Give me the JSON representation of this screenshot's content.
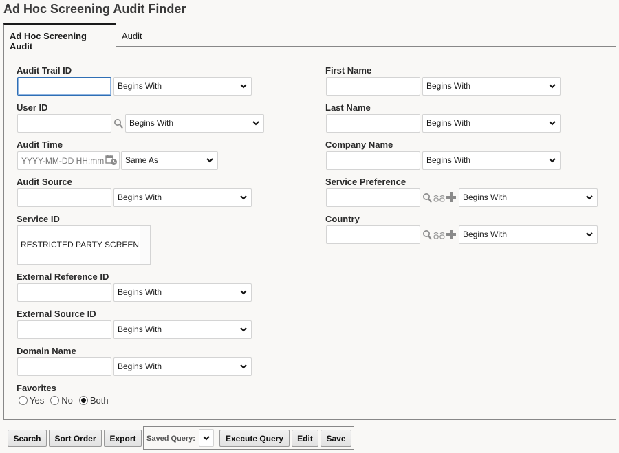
{
  "page": {
    "title": "Ad Hoc Screening Audit Finder"
  },
  "tabs": [
    {
      "label": "Ad Hoc Screening Audit",
      "active": true
    },
    {
      "label": "Audit",
      "active": false
    }
  ],
  "left_fields": {
    "audit_trail_id": {
      "label": "Audit Trail ID",
      "value": "",
      "operator": "Begins With"
    },
    "user_id": {
      "label": "User ID",
      "value": "",
      "operator": "Begins With",
      "icon": "search-icon"
    },
    "audit_time": {
      "label": "Audit Time",
      "placeholder": "YYYY-MM-DD HH:mm",
      "operator": "Same As",
      "icon": "calendar-clock-icon"
    },
    "audit_source": {
      "label": "Audit Source",
      "value": "",
      "operator": "Begins With"
    },
    "service_id": {
      "label": "Service ID",
      "options": [
        "RESTRICTED PARTY SCREEN"
      ]
    },
    "external_reference_id": {
      "label": "External Reference ID",
      "value": "",
      "operator": "Begins With"
    },
    "external_source_id": {
      "label": "External Source ID",
      "value": "",
      "operator": "Begins With"
    },
    "domain_name": {
      "label": "Domain Name",
      "value": "",
      "operator": "Begins With"
    },
    "favorites": {
      "label": "Favorites",
      "options": [
        "Yes",
        "No",
        "Both"
      ],
      "selected": "Both"
    }
  },
  "right_fields": {
    "first_name": {
      "label": "First Name",
      "value": "",
      "operator": "Begins With"
    },
    "last_name": {
      "label": "Last Name",
      "value": "",
      "operator": "Begins With"
    },
    "company_name": {
      "label": "Company Name",
      "value": "",
      "operator": "Begins With"
    },
    "service_preference": {
      "label": "Service Preference",
      "value": "",
      "operator": "Begins With",
      "icons": [
        "search-icon",
        "glasses-icon",
        "plus-icon"
      ]
    },
    "country": {
      "label": "Country",
      "value": "",
      "operator": "Begins With",
      "icons": [
        "search-icon",
        "glasses-icon",
        "plus-icon"
      ]
    }
  },
  "toolbar": {
    "search_label": "Search",
    "sort_order_label": "Sort Order",
    "export_label": "Export",
    "saved_query_label": "Saved Query:",
    "saved_query_value": "",
    "execute_query_label": "Execute Query",
    "edit_label": "Edit",
    "save_label": "Save"
  },
  "colors": {
    "background": "#f9f8f6",
    "focus_border": "#2f6fb5",
    "panel_border": "#888888",
    "icon_gray": "#8a8a8a"
  }
}
